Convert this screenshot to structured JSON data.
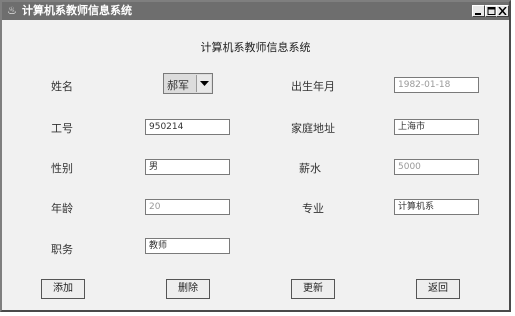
{
  "window": {
    "title": "计算机系教师信息系统",
    "icon": "app-icon"
  },
  "form": {
    "heading": "计算机系教师信息系统",
    "name_label": "姓名",
    "name_value": "郝军",
    "id_label": "工号",
    "id_value": "950214",
    "gender_label": "性别",
    "gender_value": "男",
    "age_label": "年龄",
    "age_value": "20",
    "position_label": "职务",
    "position_value": "教师",
    "birth_label": "出生年月",
    "birth_value": "1982-01-18",
    "address_label": "家庭地址",
    "address_value": "上海市",
    "salary_label": "薪水",
    "salary_value": "5000",
    "major_label": "专业",
    "major_value": "计算机系"
  },
  "buttons": {
    "add": "添加",
    "delete": "删除",
    "update": "更新",
    "back": "返回"
  }
}
